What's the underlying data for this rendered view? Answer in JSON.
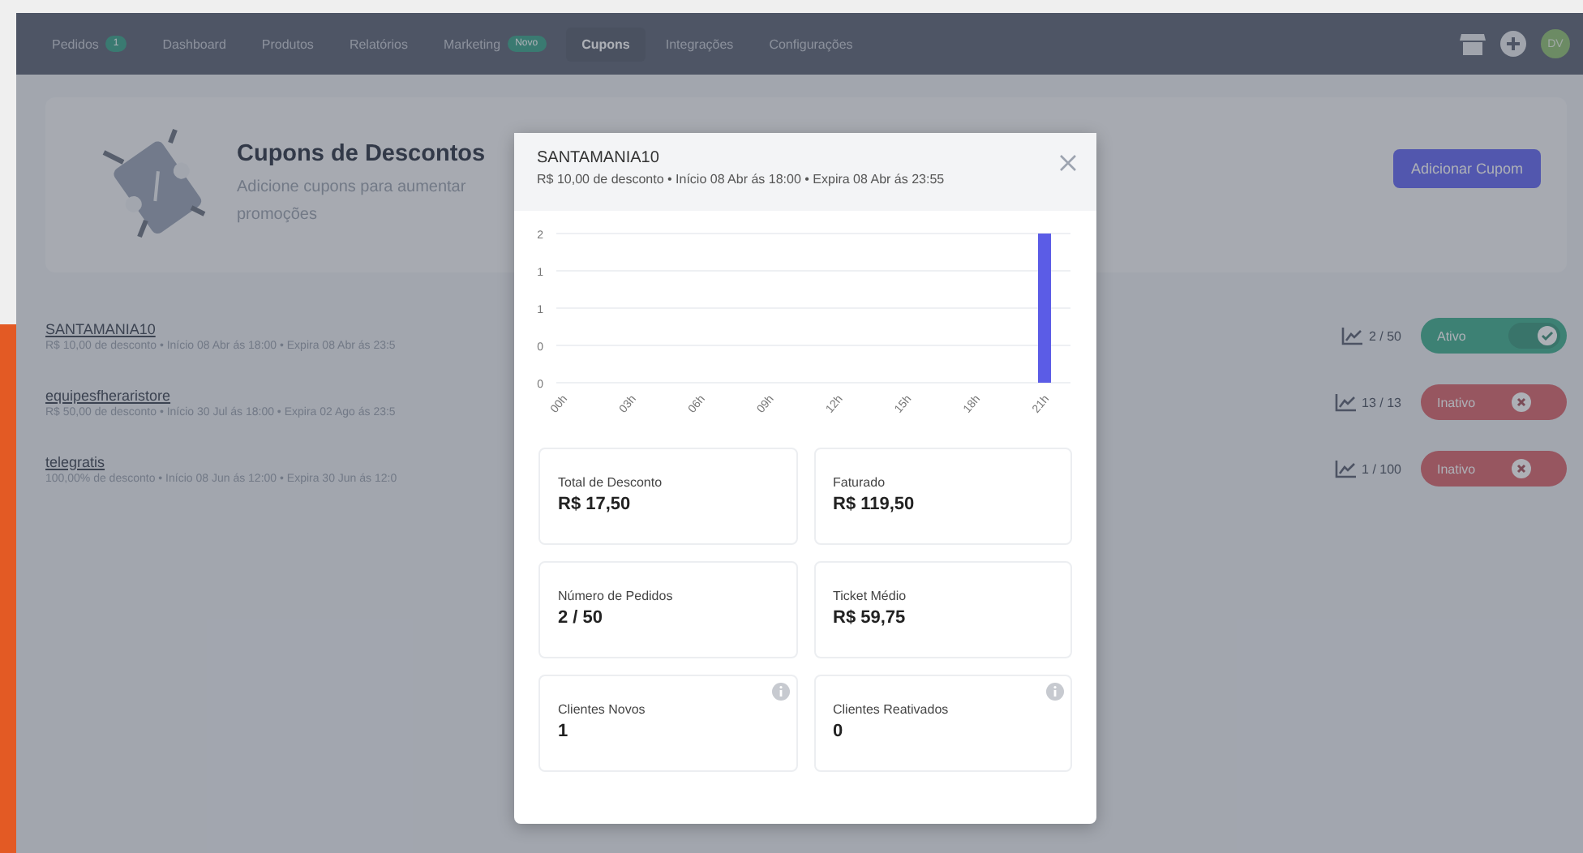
{
  "nav": {
    "items": [
      {
        "label": "Pedidos",
        "badge": "1",
        "selected": false
      },
      {
        "label": "Dashboard",
        "selected": false
      },
      {
        "label": "Produtos",
        "selected": false
      },
      {
        "label": "Relatórios",
        "selected": false
      },
      {
        "label": "Marketing",
        "badge": "Novo",
        "selected": false
      },
      {
        "label": "Cupons",
        "selected": true
      },
      {
        "label": "Integrações",
        "selected": false
      },
      {
        "label": "Configurações",
        "selected": false
      }
    ],
    "avatar": "DV"
  },
  "header": {
    "title": "Cupons de Descontos",
    "subtitle": "Adicione cupons para aumentar",
    "subtitle_2": "promoções",
    "button": "Adicionar Cupom"
  },
  "coupons": [
    {
      "name": "SANTAMANIA10",
      "details": "R$ 10,00 de desconto • Início 08 Abr ás 18:00 • Expira 08 Abr ás 23:5",
      "usage": "2 / 50",
      "status": "Ativo",
      "active": true
    },
    {
      "name": "equipesfheraristore",
      "details": "R$ 50,00 de desconto • Início 30 Jul ás 18:00 • Expira 02 Ago ás 23:5",
      "usage": "13 / 13",
      "status": "Inativo",
      "active": false
    },
    {
      "name": "telegratis",
      "details": "100,00% de desconto • Início 08 Jun ás 12:00 • Expira 30 Jun ás 12:0",
      "usage": "1 / 100",
      "status": "Inativo",
      "active": false
    }
  ],
  "modal": {
    "title": "SANTAMANIA10",
    "subtitle": "R$ 10,00 de desconto • Início 08 Abr ás 18:00 • Expira 08 Abr ás 23:55",
    "chart_data": {
      "type": "bar",
      "categories": [
        "00h",
        "03h",
        "06h",
        "09h",
        "12h",
        "15h",
        "18h",
        "21h"
      ],
      "series": [
        {
          "color": "#5b5ce6",
          "values": [
            0,
            0,
            0,
            0,
            0,
            0,
            0,
            2
          ]
        }
      ],
      "grid": true,
      "ylim": [
        0,
        2
      ],
      "yticks": [
        0,
        {
          "value": 0.5,
          "label": "0"
        },
        1,
        {
          "value": 1.5,
          "label": "1"
        },
        2
      ]
    },
    "stats": [
      {
        "label": "Total de Desconto",
        "value": "R$ 17,50",
        "info": false
      },
      {
        "label": "Faturado",
        "value": "R$ 119,50",
        "info": false
      },
      {
        "label": "Número de Pedidos",
        "value": "2 / 50",
        "info": false
      },
      {
        "label": "Ticket Médio",
        "value": "R$ 59,75",
        "info": false
      },
      {
        "label": "Clientes Novos",
        "value": "1",
        "info": true
      },
      {
        "label": "Clientes Reativados",
        "value": "0",
        "info": true
      }
    ]
  }
}
